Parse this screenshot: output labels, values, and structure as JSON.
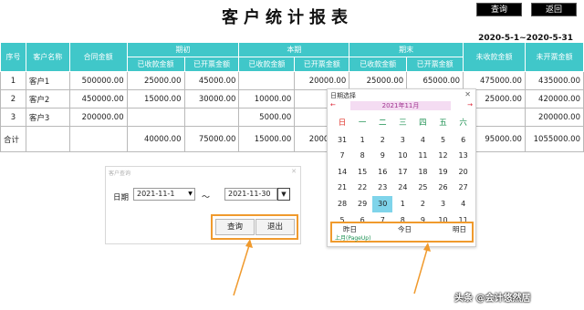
{
  "title": "客户统计报表",
  "toolbar": {
    "query_label": "查询",
    "back_label": "返回"
  },
  "date_range": "2020-5-1~2020-5-31",
  "table": {
    "header_top": {
      "seq": "序号",
      "name": "客户名称",
      "contract": "合同金额",
      "prev": "期初",
      "curr": "本期",
      "end": "期末",
      "unreceived": "未收款金额",
      "uninvoiced": "未开票金额"
    },
    "header_sub": [
      "已收款金额",
      "已开票金额",
      "已收款金额",
      "已开票金额",
      "已收款金额",
      "已开票金额"
    ],
    "rows": [
      [
        "1",
        "客户1",
        "500000.00",
        "25000.00",
        "45000.00",
        "",
        "20000.00",
        "25000.00",
        "65000.00",
        "475000.00",
        "435000.00"
      ],
      [
        "2",
        "客户2",
        "450000.00",
        "15000.00",
        "30000.00",
        "10000.00",
        "",
        "",
        "",
        "25000.00",
        "420000.00"
      ],
      [
        "3",
        "客户3",
        "200000.00",
        "",
        "",
        "5000.00",
        "",
        "",
        "",
        "",
        "200000.00"
      ]
    ],
    "total": [
      "合计",
      "",
      "",
      "40000.00",
      "75000.00",
      "15000.00",
      "20000.00",
      "",
      "",
      "95000.00",
      "1055000.00"
    ]
  },
  "query_dialog": {
    "title": "客户查询",
    "date_label": "日期",
    "from_value": "2021-11-1",
    "to_value": "2021-11-30",
    "separator": "～",
    "query_label": "查询",
    "exit_label": "退出"
  },
  "calendar": {
    "title": "日期选择",
    "month_label": "2021年11月",
    "weekdays": [
      "日",
      "一",
      "二",
      "三",
      "四",
      "五",
      "六"
    ],
    "weeks": [
      [
        "31",
        "1",
        "2",
        "3",
        "4",
        "5",
        "6"
      ],
      [
        "7",
        "8",
        "9",
        "10",
        "11",
        "12",
        "13"
      ],
      [
        "14",
        "15",
        "16",
        "17",
        "18",
        "19",
        "20"
      ],
      [
        "21",
        "22",
        "23",
        "24",
        "25",
        "26",
        "27"
      ],
      [
        "28",
        "29",
        "30",
        "1",
        "2",
        "3",
        "4"
      ],
      [
        "5",
        "6",
        "7",
        "8",
        "9",
        "10",
        "11"
      ]
    ],
    "selected_day": "30",
    "yesterday_label": "昨日",
    "today_label": "今日",
    "tomorrow_label": "明日",
    "page_hint": "上月(PageUp)"
  },
  "watermark": "头条 @会计悠然居",
  "colors": {
    "header_bg": "#40c7c9",
    "highlight": "#f09a2d",
    "today_bg": "#7fd4ea"
  }
}
